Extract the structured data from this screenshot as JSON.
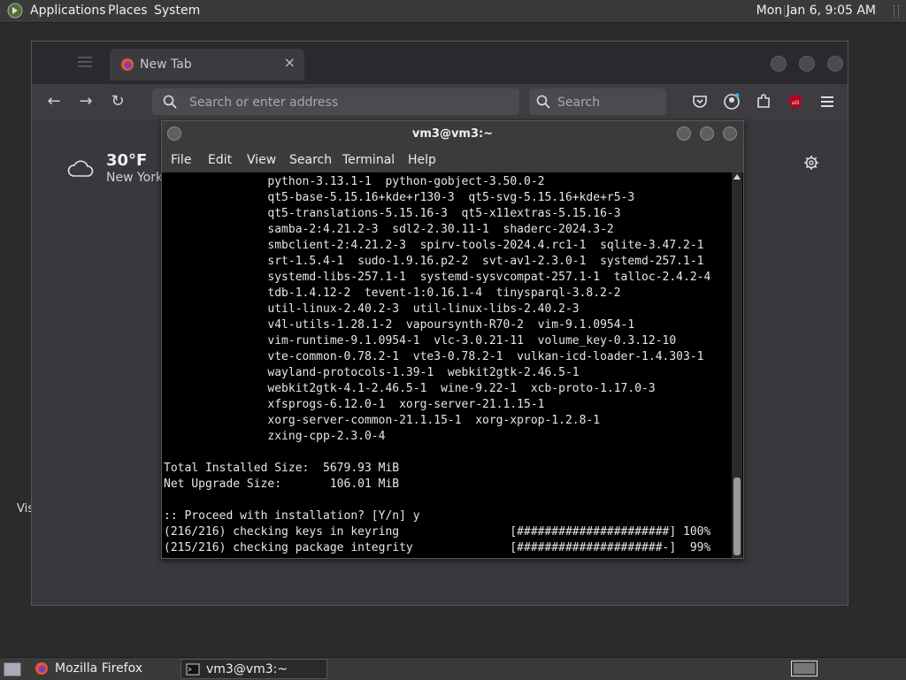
{
  "top_panel": {
    "menus": [
      "Applications",
      "Places",
      "System"
    ],
    "clock": "Mon Jan  6,  9:05 AM"
  },
  "desktop": {
    "partial_label": "Vis"
  },
  "firefox": {
    "tab": {
      "label": "New Tab",
      "close": "×"
    },
    "url_placeholder": "Search or enter address",
    "search_placeholder": "Search",
    "weather": {
      "temperature": "30°F",
      "city": "New York"
    }
  },
  "terminal": {
    "title": "vm3@vm3:~",
    "menus": [
      "File",
      "Edit",
      "View",
      "Search",
      "Terminal",
      "Help"
    ],
    "lines": [
      "               python-3.13.1-1  python-gobject-3.50.0-2",
      "               qt5-base-5.15.16+kde+r130-3  qt5-svg-5.15.16+kde+r5-3",
      "               qt5-translations-5.15.16-3  qt5-x11extras-5.15.16-3",
      "               samba-2:4.21.2-3  sdl2-2.30.11-1  shaderc-2024.3-2",
      "               smbclient-2:4.21.2-3  spirv-tools-2024.4.rc1-1  sqlite-3.47.2-1",
      "               srt-1.5.4-1  sudo-1.9.16.p2-2  svt-av1-2.3.0-1  systemd-257.1-1",
      "               systemd-libs-257.1-1  systemd-sysvcompat-257.1-1  talloc-2.4.2-4",
      "               tdb-1.4.12-2  tevent-1:0.16.1-4  tinysparql-3.8.2-2",
      "               util-linux-2.40.2-3  util-linux-libs-2.40.2-3",
      "               v4l-utils-1.28.1-2  vapoursynth-R70-2  vim-9.1.0954-1",
      "               vim-runtime-9.1.0954-1  vlc-3.0.21-11  volume_key-0.3.12-10",
      "               vte-common-0.78.2-1  vte3-0.78.2-1  vulkan-icd-loader-1.4.303-1",
      "               wayland-protocols-1.39-1  webkit2gtk-2.46.5-1",
      "               webkit2gtk-4.1-2.46.5-1  wine-9.22-1  xcb-proto-1.17.0-3",
      "               xfsprogs-6.12.0-1  xorg-server-21.1.15-1",
      "               xorg-server-common-21.1.15-1  xorg-xprop-1.2.8-1",
      "               zxing-cpp-2.3.0-4",
      "",
      "Total Installed Size:  5679.93 MiB",
      "Net Upgrade Size:       106.01 MiB",
      "",
      ":: Proceed with installation? [Y/n] y",
      "(216/216) checking keys in keyring                [######################] 100%",
      "(215/216) checking package integrity              [#####################-]  99%"
    ]
  },
  "taskbar": {
    "items": [
      "Mozilla Firefox",
      "vm3@vm3:~"
    ]
  },
  "colors": {
    "panel": "#3a3a3a",
    "terminal_bg": "#000000",
    "firefox_bg": "#38383d"
  }
}
